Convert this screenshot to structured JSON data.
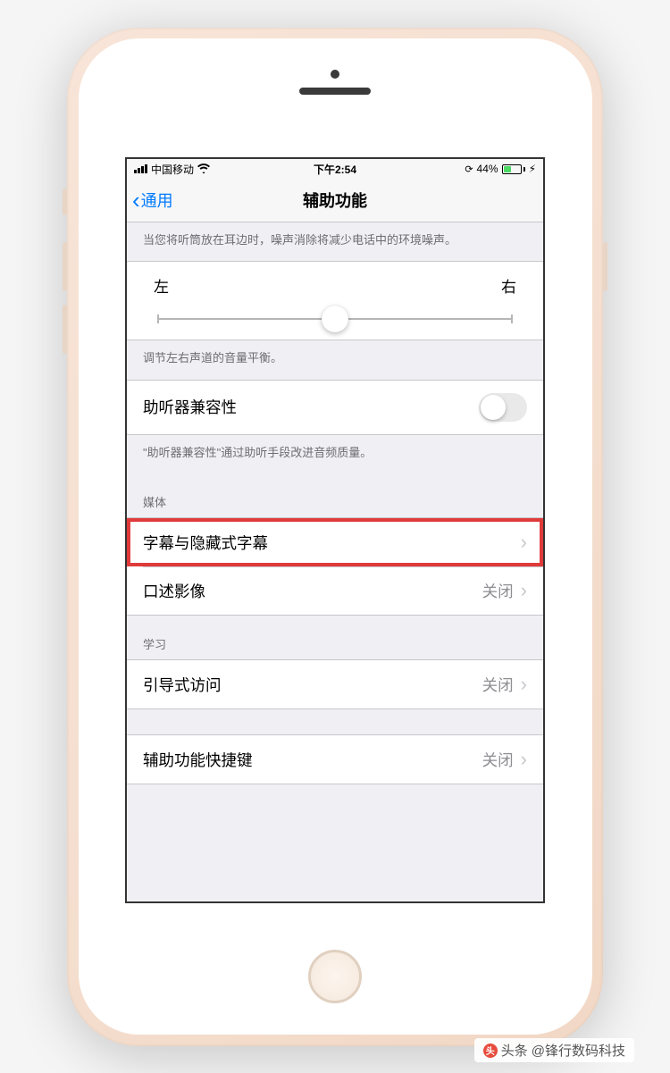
{
  "statusBar": {
    "carrier": "中国移动",
    "time": "下午2:54",
    "batteryPercent": "44%"
  },
  "nav": {
    "backLabel": "通用",
    "title": "辅助功能"
  },
  "footers": {
    "noiseCancel": "当您将听筒放在耳边时，噪声消除将减少电话中的环境噪声。",
    "balance": "调节左右声道的音量平衡。",
    "hearingAid": "\"助听器兼容性\"通过助听手段改进音频质量。"
  },
  "slider": {
    "left": "左",
    "right": "右"
  },
  "cells": {
    "hearingAidLabel": "助听器兼容性",
    "mediaHeader": "媒体",
    "subtitlesLabel": "字幕与隐藏式字幕",
    "audioDescLabel": "口述影像",
    "audioDescValue": "关闭",
    "learningHeader": "学习",
    "guidedAccessLabel": "引导式访问",
    "guidedAccessValue": "关闭",
    "shortcutLabel": "辅助功能快捷键",
    "shortcutValue": "关闭"
  },
  "watermark": {
    "prefix": "头条",
    "handle": "@锋行数码科技"
  }
}
